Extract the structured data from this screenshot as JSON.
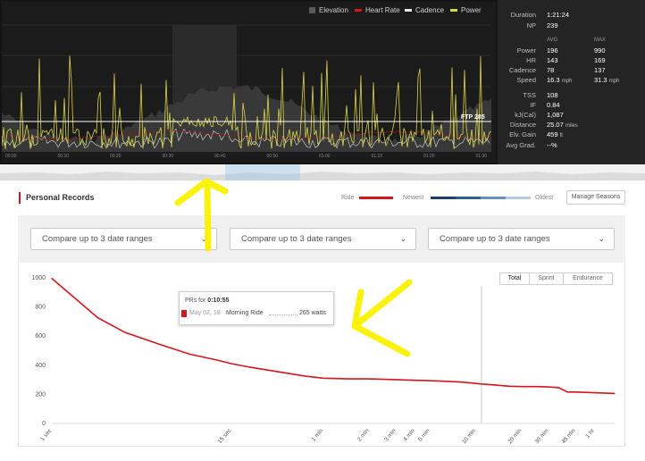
{
  "legend": {
    "elevation": "Elevation",
    "heart_rate": "Heart Rate",
    "cadence": "Cadence",
    "power": "Power"
  },
  "colors": {
    "power": "#d8d54a",
    "heart_rate": "#d4161f",
    "cadence": "#e6e6e6",
    "elevation": "#5a5a5a",
    "accent_red": "#d4161f",
    "annotation_yellow": "#fbf20a"
  },
  "ftp_label": "FTP 285",
  "time_ticks": [
    "00:00",
    "00:10",
    "00:20",
    "00:30",
    "00:40",
    "00:50",
    "01:00",
    "01:10",
    "01:20",
    "01:30"
  ],
  "stats": {
    "duration_label": "Duration",
    "duration": "1:21:24",
    "np_label": "NP",
    "np": "239",
    "avg_header": "AVG",
    "max_header": "MAX",
    "power_label": "Power",
    "power_avg": "196",
    "power_max": "990",
    "hr_label": "HR",
    "hr_avg": "143",
    "hr_max": "169",
    "cadence_label": "Cadence",
    "cadence_avg": "78",
    "cadence_max": "137",
    "speed_label": "Speed",
    "speed_avg": "16.3",
    "speed_max": "31.3",
    "speed_unit": "mph",
    "tss_label": "TSS",
    "tss": "108",
    "if_label": "IF",
    "if": "0.84",
    "kj_label": "kJ(Cal)",
    "kj": "1,087",
    "distance_label": "Distance",
    "distance": "25.07",
    "distance_unit": "miles",
    "elv_label": "Elv. Gain",
    "elv": "459",
    "elv_unit": "ft",
    "grad_label": "Avg Grad.",
    "grad": "--%"
  },
  "personal_records": {
    "title": "Personal Records",
    "ride_label": "Ride",
    "newest_label": "Newest",
    "oldest_label": "Oldest",
    "manage_button": "Manage Seasons",
    "compare_placeholder": "Compare up to 3 date ranges",
    "tabs": [
      "Total",
      "Sprint",
      "Endurance"
    ],
    "tooltip": {
      "prefix": "PRs for",
      "duration": "0:10:55",
      "date": "May 02, 18",
      "ride": "Morning Ride",
      "value": "265 watts"
    }
  },
  "chart_data": {
    "type": "line",
    "title": "",
    "x_scale": "log",
    "y_ticks": [
      "1000",
      "800",
      "600",
      "400",
      "200",
      "0"
    ],
    "ylim": [
      0,
      1000
    ],
    "x_ticks": [
      "1 sec",
      "15 sec",
      "1 min",
      "2 min",
      "3 min",
      "4 min",
      "5 min",
      "10 min",
      "20 min",
      "30 min",
      "45 min",
      "1 hr"
    ],
    "x_tick_seconds": [
      1,
      15,
      60,
      120,
      180,
      240,
      300,
      600,
      1200,
      1800,
      2700,
      3600
    ],
    "series": [
      {
        "x": [
          1,
          2,
          3,
          5,
          8,
          12,
          15,
          20,
          30,
          45,
          60,
          90,
          120,
          180,
          240,
          300,
          400,
          500,
          655,
          800,
          1000,
          1200,
          1500,
          1800,
          2100,
          2400,
          2700,
          3000,
          3600,
          4884
        ],
        "y": [
          990,
          720,
          620,
          540,
          470,
          430,
          405,
          380,
          350,
          320,
          305,
          300,
          300,
          295,
          290,
          288,
          283,
          277,
          265,
          258,
          250,
          247,
          247,
          245,
          240,
          210,
          210,
          208,
          205,
          200
        ]
      }
    ],
    "hover_x": 655,
    "legend": "top-right",
    "grid": false
  }
}
